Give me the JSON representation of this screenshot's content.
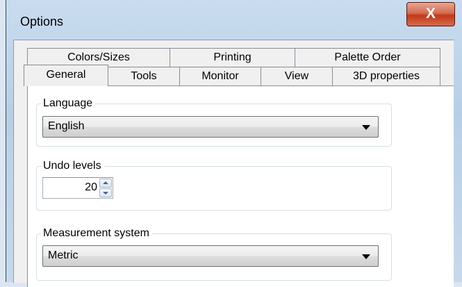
{
  "window": {
    "title": "Options",
    "close_glyph": "X"
  },
  "tabs": {
    "back_row": [
      "Colors/Sizes",
      "Printing",
      "Palette Order"
    ],
    "front_row": [
      "General",
      "Tools",
      "Monitor",
      "View",
      "3D properties"
    ],
    "selected": "General"
  },
  "general": {
    "language": {
      "label": "Language",
      "value": "English"
    },
    "undo_levels": {
      "label": "Undo levels",
      "value": "20"
    },
    "measurement": {
      "label": "Measurement system",
      "value": "Metric"
    }
  },
  "colors": {
    "accent_close": "#c2381b",
    "panel_bg": "#ffffff",
    "frame_bg": "#b7cfe6"
  }
}
